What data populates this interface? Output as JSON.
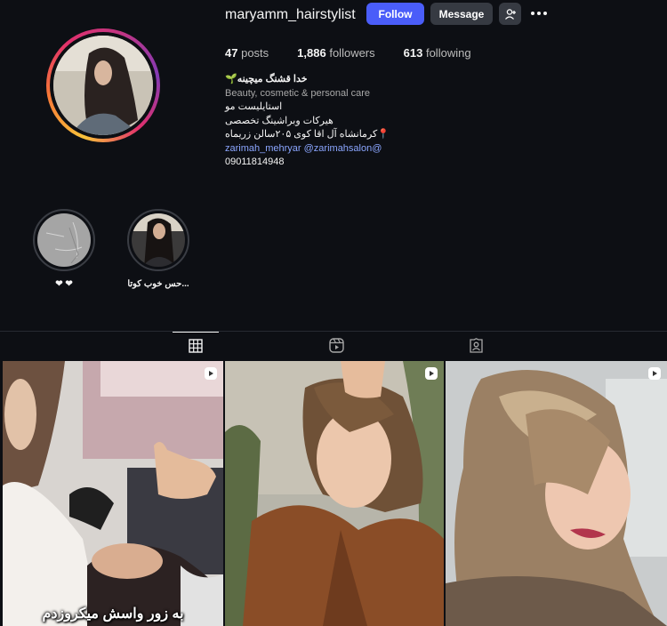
{
  "profile": {
    "username": "maryamm_hairstylist",
    "buttons": {
      "follow": "Follow",
      "message": "Message"
    },
    "stats": {
      "posts_count": "47",
      "posts_label": "posts",
      "followers_count": "1,886",
      "followers_label": "followers",
      "following_count": "613",
      "following_label": "following"
    },
    "bio": {
      "name": "خدا قشنگ میچینه🌱",
      "category": "Beauty, cosmetic & personal care",
      "lines": [
        "استایلیست مو",
        "هیرکات وبراشینگ تخصصی",
        "📍کرمانشاه آل اقا کوی ۲۰۵سالن زریماه"
      ],
      "mentions": "zarimah_mehryar @zarimahsalon@",
      "phone": "09011814948"
    }
  },
  "highlights": [
    {
      "label": "حس خوب کوتا..."
    },
    {
      "label": "❤ ❤"
    }
  ],
  "tabs": [
    {
      "icon": "grid-icon",
      "active": true
    },
    {
      "icon": "reels-icon",
      "active": false
    },
    {
      "icon": "tagged-icon",
      "active": false
    }
  ],
  "posts": [
    {
      "type": "reel",
      "caption": "به زور واسش میکروزدم"
    },
    {
      "type": "reel",
      "caption": ""
    },
    {
      "type": "reel",
      "caption": ""
    }
  ],
  "colors": {
    "background": "#0d0f14",
    "follow_button": "#4a5df9",
    "secondary_button": "#363a42",
    "link": "#8ba6ff"
  }
}
